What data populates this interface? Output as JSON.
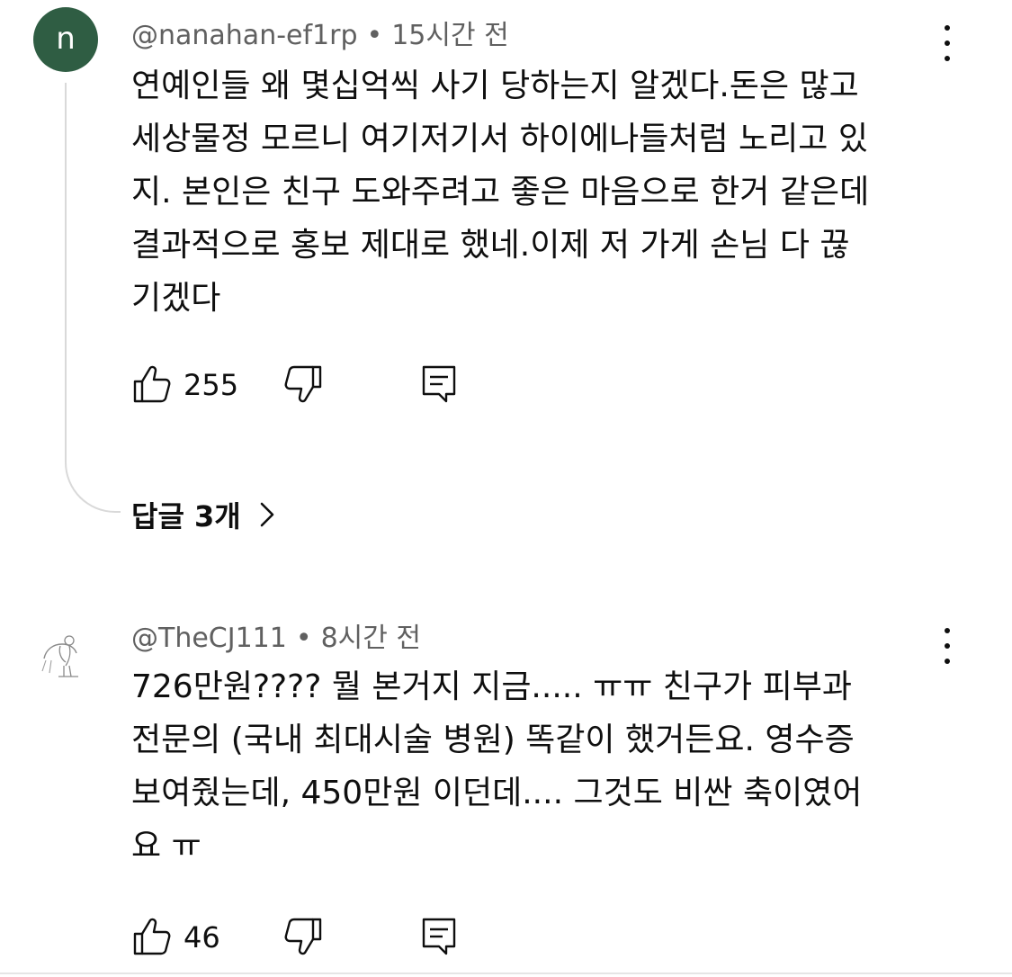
{
  "comments": [
    {
      "avatar_letter": "n",
      "author": "@nanahan-ef1rp",
      "separator": "•",
      "time": "15시간 전",
      "text": "연예인들 왜 몇십억씩 사기 당하는지 알겠다.돈은 많고\n세상물정 모르니 여기저기서 하이에나들처럼 노리고 있\n지. 본인은 친구 도와주려고 좋은 마음으로 한거 같은데\n결과적으로 홍보 제대로 했네.이제 저 가게 손님 다 끊\n기겠다",
      "likes": "255",
      "replies_label": "답글 3개"
    },
    {
      "author": "@TheCJ111",
      "separator": "•",
      "time": "8시간 전",
      "text": "726만원???? 뭘 본거지 지금..... ㅠㅠ 친구가 피부과\n전문의 (국내 최대시술 병원) 똑같이 했거든요. 영수증\n보여줬는데, 450만원 이던데.... 그것도 비싼 축이였어\n요 ㅠ",
      "likes": "46"
    }
  ],
  "icons": {
    "like": "thumbs-up-icon",
    "dislike": "thumbs-down-icon",
    "reply": "reply-comment-icon",
    "more": "more-vertical-icon",
    "chevron": "chevron-right-icon"
  },
  "colors": {
    "avatar_bg": "#2f5d43",
    "meta_text": "#606060",
    "body_text": "#0f0f0f",
    "thread_line": "#d9d9d9"
  }
}
